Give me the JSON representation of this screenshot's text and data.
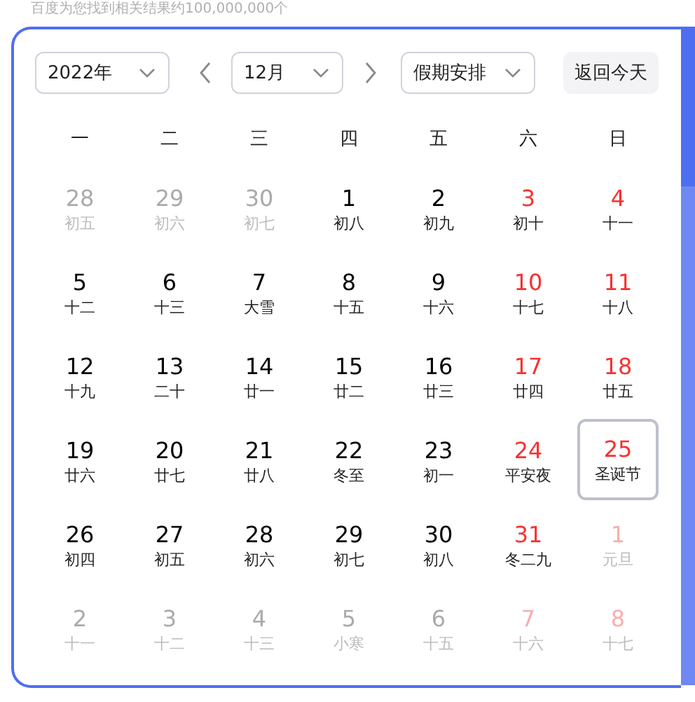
{
  "result_count": "百度为您找到相关结果约100,000,000个",
  "controls": {
    "year": "2022年",
    "month": "12月",
    "holiday": "假期安排",
    "today_button": "返回今天"
  },
  "weekdays": [
    "一",
    "二",
    "三",
    "四",
    "五",
    "六",
    "日"
  ],
  "days": [
    {
      "day": "28",
      "lunar": "初五",
      "muted": true,
      "red": false,
      "selected": false
    },
    {
      "day": "29",
      "lunar": "初六",
      "muted": true,
      "red": false,
      "selected": false
    },
    {
      "day": "30",
      "lunar": "初七",
      "muted": true,
      "red": false,
      "selected": false
    },
    {
      "day": "1",
      "lunar": "初八",
      "muted": false,
      "red": false,
      "selected": false
    },
    {
      "day": "2",
      "lunar": "初九",
      "muted": false,
      "red": false,
      "selected": false
    },
    {
      "day": "3",
      "lunar": "初十",
      "muted": false,
      "red": true,
      "selected": false
    },
    {
      "day": "4",
      "lunar": "十一",
      "muted": false,
      "red": true,
      "selected": false
    },
    {
      "day": "5",
      "lunar": "十二",
      "muted": false,
      "red": false,
      "selected": false
    },
    {
      "day": "6",
      "lunar": "十三",
      "muted": false,
      "red": false,
      "selected": false
    },
    {
      "day": "7",
      "lunar": "大雪",
      "muted": false,
      "red": false,
      "selected": false
    },
    {
      "day": "8",
      "lunar": "十五",
      "muted": false,
      "red": false,
      "selected": false
    },
    {
      "day": "9",
      "lunar": "十六",
      "muted": false,
      "red": false,
      "selected": false
    },
    {
      "day": "10",
      "lunar": "十七",
      "muted": false,
      "red": true,
      "selected": false
    },
    {
      "day": "11",
      "lunar": "十八",
      "muted": false,
      "red": true,
      "selected": false
    },
    {
      "day": "12",
      "lunar": "十九",
      "muted": false,
      "red": false,
      "selected": false
    },
    {
      "day": "13",
      "lunar": "二十",
      "muted": false,
      "red": false,
      "selected": false
    },
    {
      "day": "14",
      "lunar": "廿一",
      "muted": false,
      "red": false,
      "selected": false
    },
    {
      "day": "15",
      "lunar": "廿二",
      "muted": false,
      "red": false,
      "selected": false
    },
    {
      "day": "16",
      "lunar": "廿三",
      "muted": false,
      "red": false,
      "selected": false
    },
    {
      "day": "17",
      "lunar": "廿四",
      "muted": false,
      "red": true,
      "selected": false
    },
    {
      "day": "18",
      "lunar": "廿五",
      "muted": false,
      "red": true,
      "selected": false
    },
    {
      "day": "19",
      "lunar": "廿六",
      "muted": false,
      "red": false,
      "selected": false
    },
    {
      "day": "20",
      "lunar": "廿七",
      "muted": false,
      "red": false,
      "selected": false
    },
    {
      "day": "21",
      "lunar": "廿八",
      "muted": false,
      "red": false,
      "selected": false
    },
    {
      "day": "22",
      "lunar": "冬至",
      "muted": false,
      "red": false,
      "selected": false
    },
    {
      "day": "23",
      "lunar": "初一",
      "muted": false,
      "red": false,
      "selected": false
    },
    {
      "day": "24",
      "lunar": "平安夜",
      "muted": false,
      "red": true,
      "selected": false
    },
    {
      "day": "25",
      "lunar": "圣诞节",
      "muted": false,
      "red": true,
      "selected": true
    },
    {
      "day": "26",
      "lunar": "初四",
      "muted": false,
      "red": false,
      "selected": false
    },
    {
      "day": "27",
      "lunar": "初五",
      "muted": false,
      "red": false,
      "selected": false
    },
    {
      "day": "28",
      "lunar": "初六",
      "muted": false,
      "red": false,
      "selected": false
    },
    {
      "day": "29",
      "lunar": "初七",
      "muted": false,
      "red": false,
      "selected": false
    },
    {
      "day": "30",
      "lunar": "初八",
      "muted": false,
      "red": false,
      "selected": false
    },
    {
      "day": "31",
      "lunar": "冬二九",
      "muted": false,
      "red": true,
      "selected": false
    },
    {
      "day": "1",
      "lunar": "元旦",
      "muted": true,
      "red": true,
      "selected": false
    },
    {
      "day": "2",
      "lunar": "十一",
      "muted": true,
      "red": false,
      "selected": false
    },
    {
      "day": "3",
      "lunar": "十二",
      "muted": true,
      "red": false,
      "selected": false
    },
    {
      "day": "4",
      "lunar": "十三",
      "muted": true,
      "red": false,
      "selected": false
    },
    {
      "day": "5",
      "lunar": "小寒",
      "muted": true,
      "red": false,
      "selected": false
    },
    {
      "day": "6",
      "lunar": "十五",
      "muted": true,
      "red": false,
      "selected": false
    },
    {
      "day": "7",
      "lunar": "十六",
      "muted": true,
      "red": true,
      "selected": false
    },
    {
      "day": "8",
      "lunar": "十七",
      "muted": true,
      "red": true,
      "selected": false
    }
  ]
}
